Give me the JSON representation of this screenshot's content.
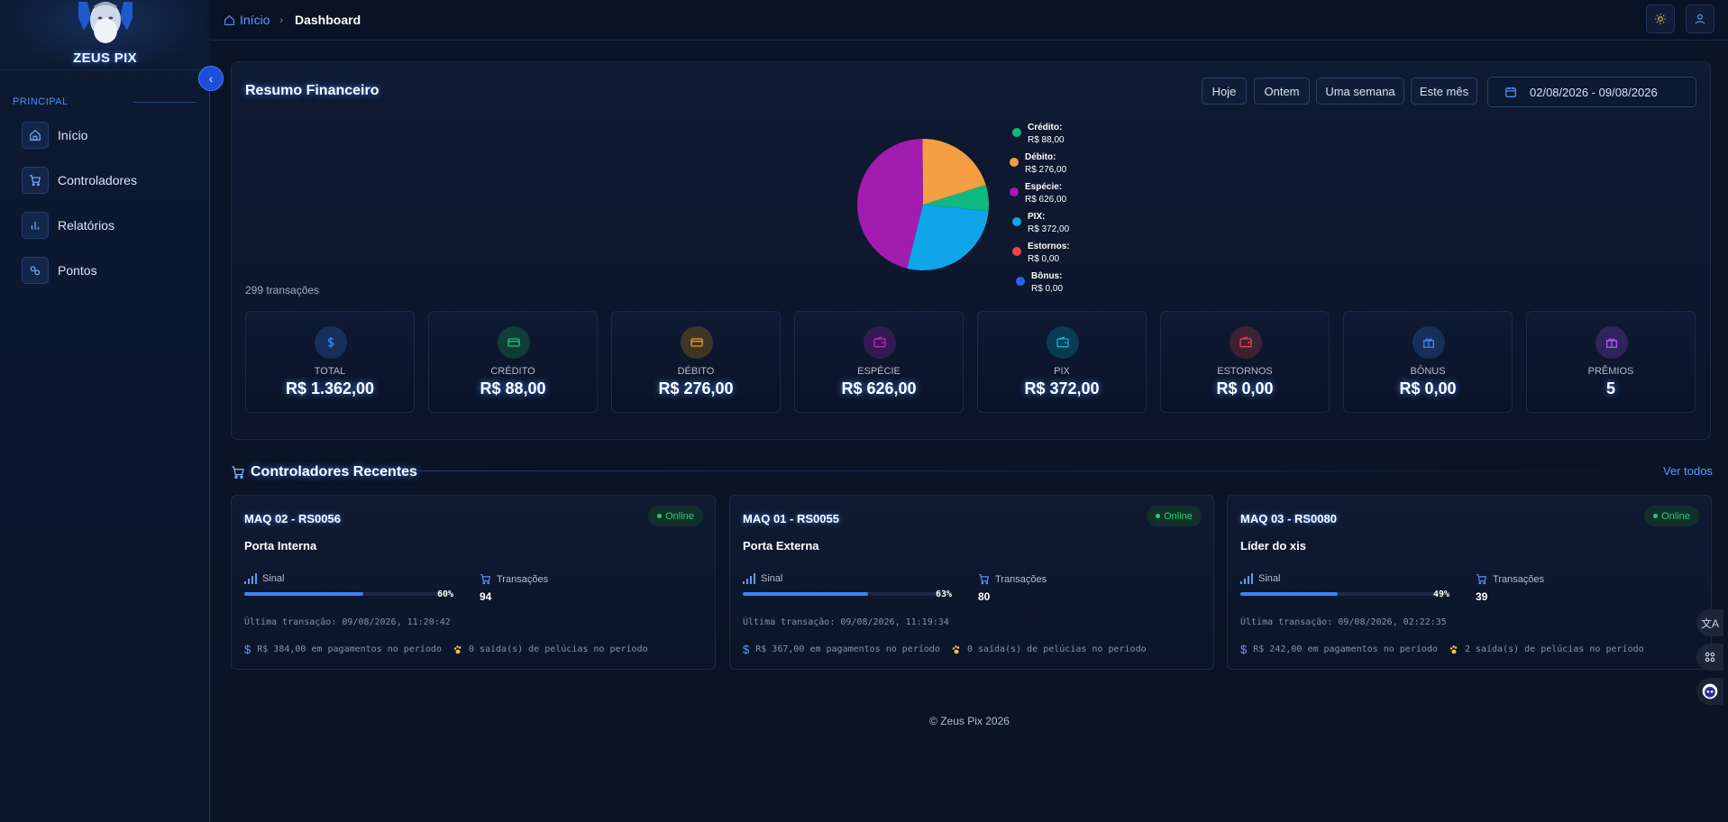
{
  "brand": {
    "logo_text": "ZEUS PIX"
  },
  "sidebar": {
    "section_label": "PRINCIPAL",
    "items": [
      {
        "label": "Início",
        "icon": "home-icon"
      },
      {
        "label": "Controladores",
        "icon": "cart-icon"
      },
      {
        "label": "Relatórios",
        "icon": "bar-chart-icon"
      },
      {
        "label": "Pontos",
        "icon": "map-pin-icon"
      }
    ]
  },
  "topbar": {
    "breadcrumb_home": "Início",
    "breadcrumb_current": "Dashboard"
  },
  "summary": {
    "title": "Resumo Financeiro",
    "periods": [
      "Hoje",
      "Ontem",
      "Uma semana",
      "Este mês"
    ],
    "date_range": "02/08/2026 - 09/08/2026",
    "transactions_text": "299 transações",
    "cards": [
      {
        "label": "TOTAL",
        "value": "R$ 1.362,00",
        "icon": "dollar-icon",
        "color": "#3b82f6"
      },
      {
        "label": "CRÉDITO",
        "value": "R$ 88,00",
        "icon": "credit-card-icon",
        "color": "#22c55e"
      },
      {
        "label": "DÉBITO",
        "value": "R$ 276,00",
        "icon": "debit-card-icon",
        "color": "#f59e0b"
      },
      {
        "label": "ESPÉCIE",
        "value": "R$ 626,00",
        "icon": "wallet-icon",
        "color": "#c026d3"
      },
      {
        "label": "PIX",
        "value": "R$ 372,00",
        "icon": "pix-wallet-icon",
        "color": "#06b6d4"
      },
      {
        "label": "ESTORNOS",
        "value": "R$ 0,00",
        "icon": "refund-wallet-icon",
        "color": "#ef4444"
      },
      {
        "label": "BÔNUS",
        "value": "R$ 0,00",
        "icon": "gift-icon",
        "color": "#3b82f6"
      },
      {
        "label": "PRÊMIOS",
        "value": "5",
        "icon": "prize-gift-icon",
        "color": "#a855f7"
      }
    ]
  },
  "chart_data": {
    "type": "pie",
    "slices": [
      {
        "name": "Crédito:",
        "label_value": "R$ 88,00",
        "value": 88,
        "color": "#10b981"
      },
      {
        "name": "Débito:",
        "label_value": "R$ 276,00",
        "value": 276,
        "color": "#f59e42"
      },
      {
        "name": "Espécie:",
        "label_value": "R$ 626,00",
        "value": 626,
        "color": "#a21caf"
      },
      {
        "name": "PIX:",
        "label_value": "R$ 372,00",
        "value": 372,
        "color": "#0ea5e9"
      },
      {
        "name": "Estornos:",
        "label_value": "R$ 0,00",
        "value": 0,
        "color": "#ef4444"
      },
      {
        "name": "Bônus:",
        "label_value": "R$ 0,00",
        "value": 0,
        "color": "#2563eb"
      }
    ],
    "legend": "right"
  },
  "controllers": {
    "title": "Controladores Recentes",
    "see_all": "Ver todos",
    "signal_label": "Sinal",
    "transactions_label": "Transações",
    "items": [
      {
        "name": "MAQ 02 - RS0056",
        "status": "Online",
        "location": "Porta Interna",
        "signal_pct": "60%",
        "signal": 60,
        "transactions": "94",
        "last_tx": "Última transação: 09/08/2026, 11:20:42",
        "payments": "R$ 384,00 em pagamentos no período",
        "plush": "0 saída(s) de pelúcias no período"
      },
      {
        "name": "MAQ 01 - RS0055",
        "status": "Online",
        "location": "Porta Externa",
        "signal_pct": "63%",
        "signal": 63,
        "transactions": "80",
        "last_tx": "Última transação: 09/08/2026, 11:19:34",
        "payments": "R$ 367,00 em pagamentos no período",
        "plush": "0 saída(s) de pelúcias no período"
      },
      {
        "name": "MAQ 03 - RS0080",
        "status": "Online",
        "location": "Líder do xis",
        "signal_pct": "49%",
        "signal": 49,
        "transactions": "39",
        "last_tx": "Última transação: 09/08/2026, 02:22:35",
        "payments": "R$ 242,00 em pagamentos no período",
        "plush": "2 saída(s) de pelúcias no período"
      }
    ]
  },
  "footer": {
    "text": "© Zeus Pix 2026"
  }
}
